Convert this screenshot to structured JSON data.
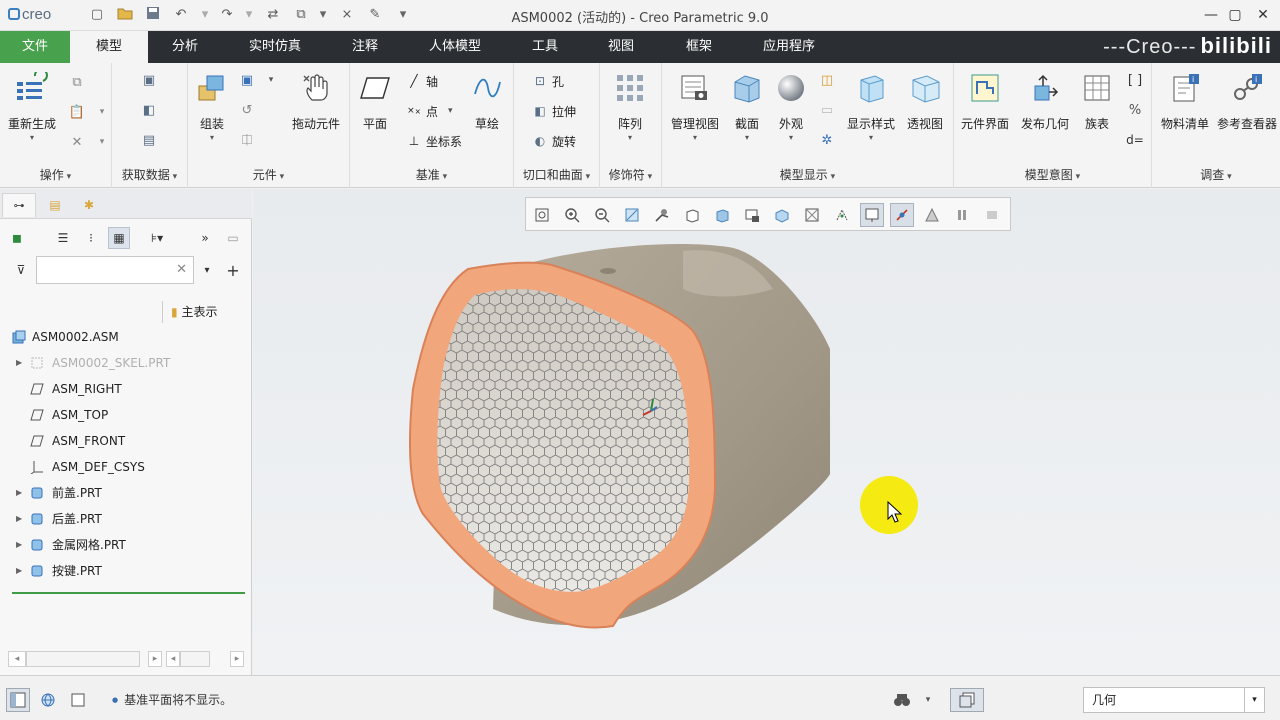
{
  "app": {
    "logo_text": "creo",
    "window_title": "ASM0002 (活动的) - Creo Parametric 9.0",
    "brand_overlay": "---Creo---",
    "brand_bili": "bilibili"
  },
  "tabs": {
    "file": "文件",
    "model": "模型",
    "analysis": "分析",
    "live_sim": "实时仿真",
    "annotate": "注释",
    "manikin": "人体模型",
    "tools": "工具",
    "view": "视图",
    "frame": "框架",
    "apps": "应用程序"
  },
  "ribbon": {
    "regenerate": "重新生成",
    "group_operations": "操作",
    "group_get_data": "获取数据",
    "assemble": "组装",
    "group_component": "元件",
    "drag_components": "拖动元件",
    "plane": "平面",
    "axis": "轴",
    "point": "点",
    "csys": "坐标系",
    "sketch": "草绘",
    "group_datum": "基准",
    "hole": "孔",
    "extrude": "拉伸",
    "revolve": "旋转",
    "group_cut_surface": "切口和曲面",
    "pattern": "阵列",
    "group_modifiers": "修饰符",
    "manage_views": "管理视图",
    "section": "截面",
    "appearance": "外观",
    "display_style": "显示样式",
    "perspective": "透视图",
    "group_model_display": "模型显示",
    "component_interface": "元件界面",
    "publish_geometry": "发布几何",
    "family_table": "族表",
    "group_model_intent": "模型意图",
    "bom": "物料清单",
    "reference_viewer": "参考查看器",
    "group_investigate": "调查"
  },
  "left_panel": {
    "filter_placeholder": "",
    "main_display": "主表示",
    "tree": [
      {
        "label": "ASM0002.ASM",
        "type": "asm"
      },
      {
        "label": "ASM0002_SKEL.PRT",
        "type": "skel"
      },
      {
        "label": "ASM_RIGHT",
        "type": "plane"
      },
      {
        "label": "ASM_TOP",
        "type": "plane"
      },
      {
        "label": "ASM_FRONT",
        "type": "plane"
      },
      {
        "label": "ASM_DEF_CSYS",
        "type": "csys"
      },
      {
        "label": "前盖.PRT",
        "type": "part"
      },
      {
        "label": "后盖.PRT",
        "type": "part"
      },
      {
        "label": "金属网格.PRT",
        "type": "part"
      },
      {
        "label": "按键.PRT",
        "type": "part"
      }
    ]
  },
  "status": {
    "message": "基准平面将不显示。",
    "filter_value": "几何"
  },
  "colors": {
    "accent_green": "#48a14d",
    "tabbar_dark": "#2b2f33",
    "model_body": "#a89f8f",
    "model_rim": "#f1a67b",
    "cursor_highlight": "#f5ea11"
  }
}
